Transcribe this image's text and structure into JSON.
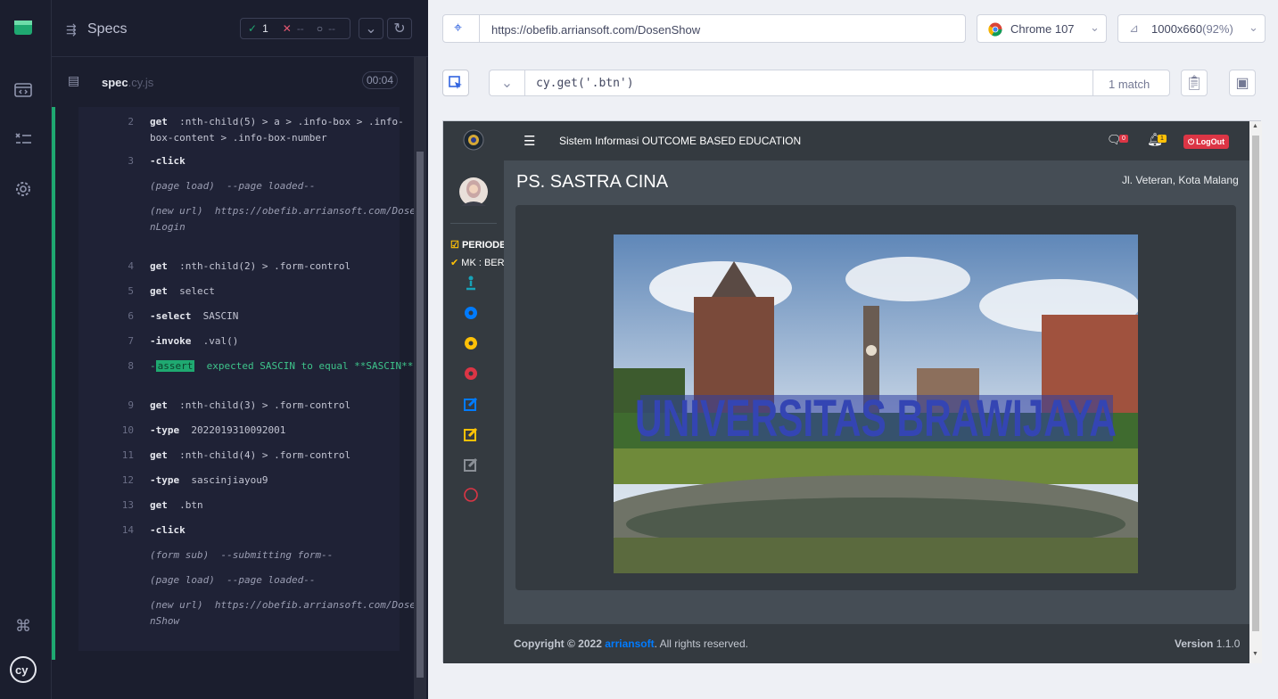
{
  "reporter": {
    "specs_title": "Specs",
    "passed_count": "1",
    "failed_count": "--",
    "pending_count": "--",
    "spec_name": "spec",
    "spec_ext": ".cy.js",
    "duration": "00:04",
    "commands": [
      {
        "num": "2",
        "name": "get",
        "arg": ":nth-child(5) > a > .info-box > .info-box-content > .info-box-number"
      },
      {
        "num": "3",
        "name": "-click",
        "arg": ""
      },
      {
        "num": "",
        "name": "(page load)",
        "arg": "--page loaded--"
      },
      {
        "num": "",
        "name": "(new url)",
        "arg": "https://obefib.arriansoft.com/DosenLogin"
      },
      {
        "num": "4",
        "name": "get",
        "arg": ":nth-child(2) > .form-control"
      },
      {
        "num": "5",
        "name": "get",
        "arg": "select"
      },
      {
        "num": "6",
        "name": "-select",
        "arg": "SASCIN"
      },
      {
        "num": "7",
        "name": "-invoke",
        "arg": ".val()"
      },
      {
        "num": "8",
        "name": "assert",
        "arg": "expected SASCIN to equal **SASCIN**"
      },
      {
        "num": "9",
        "name": "get",
        "arg": ":nth-child(3) > .form-control"
      },
      {
        "num": "10",
        "name": "-type",
        "arg": "2022019310092001"
      },
      {
        "num": "11",
        "name": "get",
        "arg": ":nth-child(4) > .form-control"
      },
      {
        "num": "12",
        "name": "-type",
        "arg": "sascinjiayou9"
      },
      {
        "num": "13",
        "name": "get",
        "arg": ".btn"
      },
      {
        "num": "14",
        "name": "-click",
        "arg": ""
      },
      {
        "num": "",
        "name": "(form sub)",
        "arg": "--submitting form--"
      },
      {
        "num": "",
        "name": "(page load)",
        "arg": "--page loaded--"
      },
      {
        "num": "",
        "name": "(new url)",
        "arg": "https://obefib.arriansoft.com/DosenShow"
      }
    ]
  },
  "browser": {
    "url": "https://obefib.arriansoft.com/DosenShow",
    "browser_name": "Chrome 107",
    "viewport": "1000x660",
    "zoom": "(92%)",
    "selector_text": "cy.get('.btn')",
    "match_count": "1 match"
  },
  "app": {
    "title": "Sistem Informasi OUTCOME BASED EDUCATION",
    "comment_badge": "0",
    "bell_badge": "1",
    "logout_label": "LogOut",
    "page_heading": "PS. SASTRA CINA",
    "location": "Jl. Veteran, Kota Malang",
    "sidebar_periode": "PERIODE",
    "sidebar_mk": "MK : BER",
    "hero_text": "UNIVERSITAS BRAWIJAYA",
    "footer_copyright": "Copyright © 2022",
    "footer_brand": "arriansoft",
    "footer_rights": ". All rights reserved.",
    "footer_version_label": "Version",
    "footer_version": "1.1.0"
  },
  "colors": {
    "pass": "#1fa971",
    "fail": "#e45770",
    "link": "#007bff",
    "logout": "#dc3545"
  }
}
